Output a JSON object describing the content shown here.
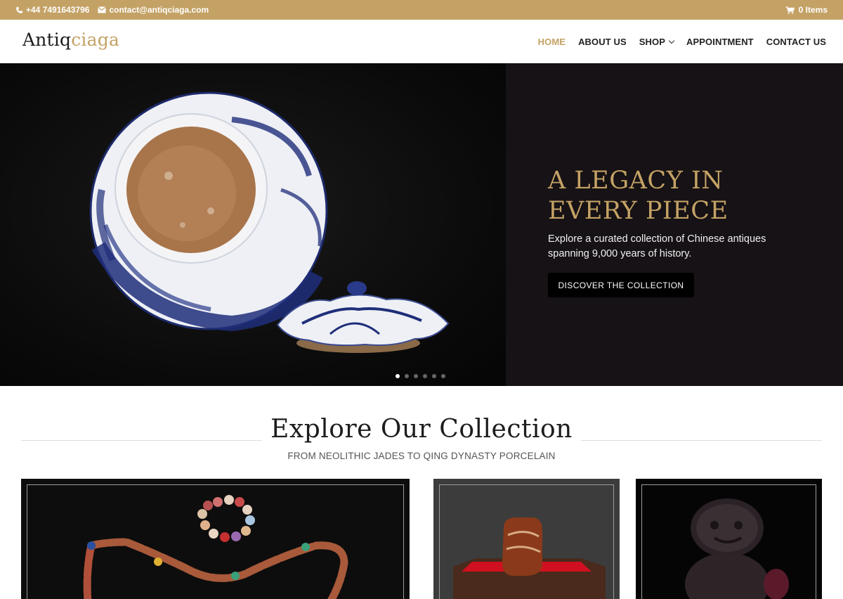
{
  "topbar": {
    "phone": "+44 7491643796",
    "email": "contact@antiqciaga.com",
    "cart": "0 Items",
    "color": "#c4a265"
  },
  "brand": {
    "logo_part1": "Antiq",
    "logo_part2": "ciaga"
  },
  "nav": {
    "home": "HOME",
    "about": "ABOUT US",
    "shop": "SHOP",
    "appointment": "APPOINTMENT",
    "contact": "CONTACT US"
  },
  "hero": {
    "title": "A LEGACY IN EVERY PIECE",
    "subtitle": "Explore a curated collection of Chinese antiques spanning 9,000 years of history.",
    "button": "DISCOVER THE COLLECTION",
    "slides": 6,
    "active_slide": 1
  },
  "collection": {
    "title": "Explore Our Collection",
    "subtitle": "FROM NEOLITHIC JADES TO QING DYNASTY PORCELAIN"
  },
  "icons": [
    "phone-icon",
    "envelope-icon",
    "cart-icon",
    "chevron-down-icon"
  ]
}
